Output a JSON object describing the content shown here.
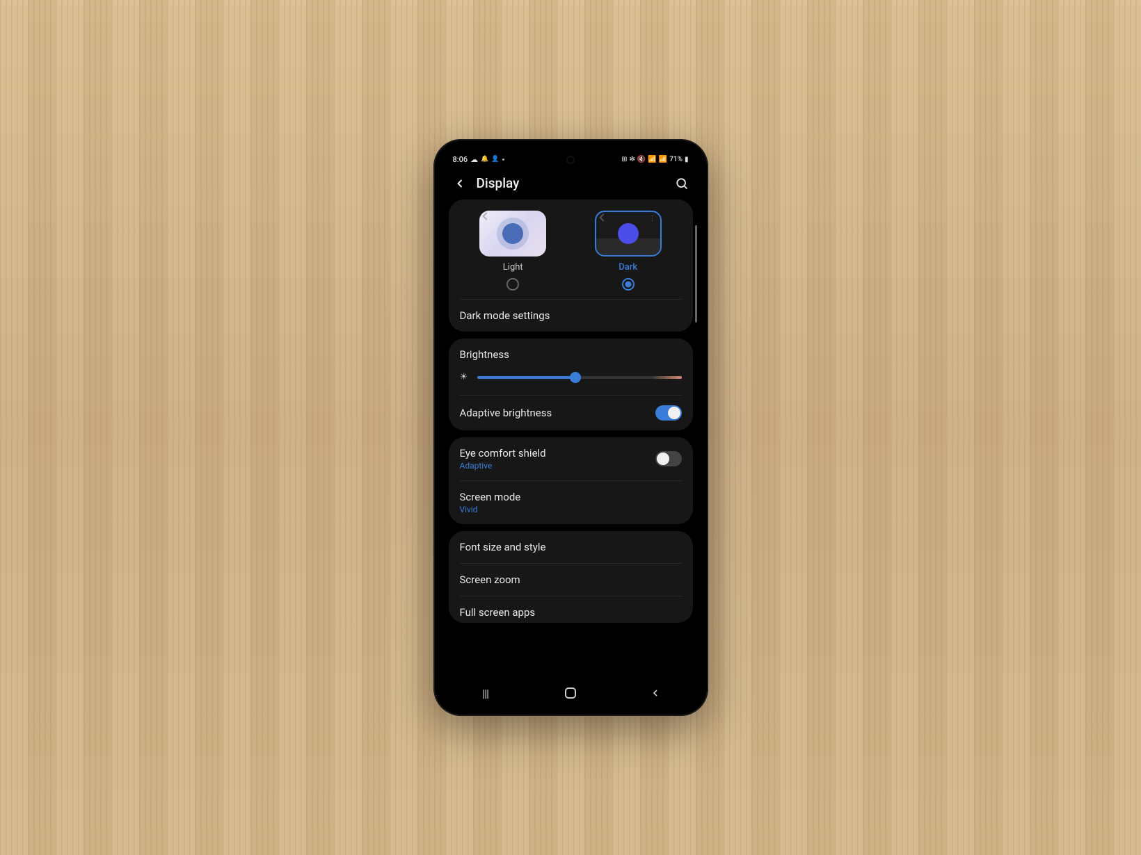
{
  "status": {
    "time": "8:06",
    "battery_text": "71%"
  },
  "header": {
    "title": "Display"
  },
  "theme": {
    "light_label": "Light",
    "dark_label": "Dark",
    "selected": "dark"
  },
  "rows": {
    "dark_mode_settings": "Dark mode settings",
    "brightness": "Brightness",
    "brightness_percent": 48,
    "adaptive_brightness": "Adaptive brightness",
    "adaptive_brightness_on": true,
    "eye_comfort": "Eye comfort shield",
    "eye_comfort_sub": "Adaptive",
    "eye_comfort_on": false,
    "screen_mode": "Screen mode",
    "screen_mode_sub": "Vivid",
    "font_size": "Font size and style",
    "screen_zoom": "Screen zoom",
    "full_screen_apps": "Full screen apps"
  }
}
